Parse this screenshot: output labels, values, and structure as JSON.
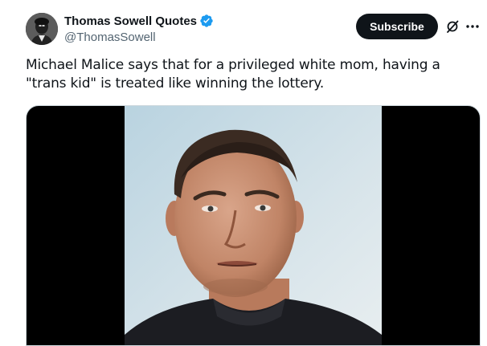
{
  "tweet": {
    "author": {
      "display_name": "Thomas Sowell Quotes",
      "handle": "@ThomasSowell",
      "verified": true,
      "verified_color": "#1d9bf0"
    },
    "subscribe_label": "Subscribe",
    "text": "Michael Malice says that for a privileged white mom, having a \"trans kid\" is treated like winning the lottery.",
    "icons": {
      "grok": "grok-icon",
      "more": "more-horizontal-icon",
      "verified": "verified-badge-icon"
    },
    "media": {
      "type": "video",
      "background": "#000000"
    }
  }
}
